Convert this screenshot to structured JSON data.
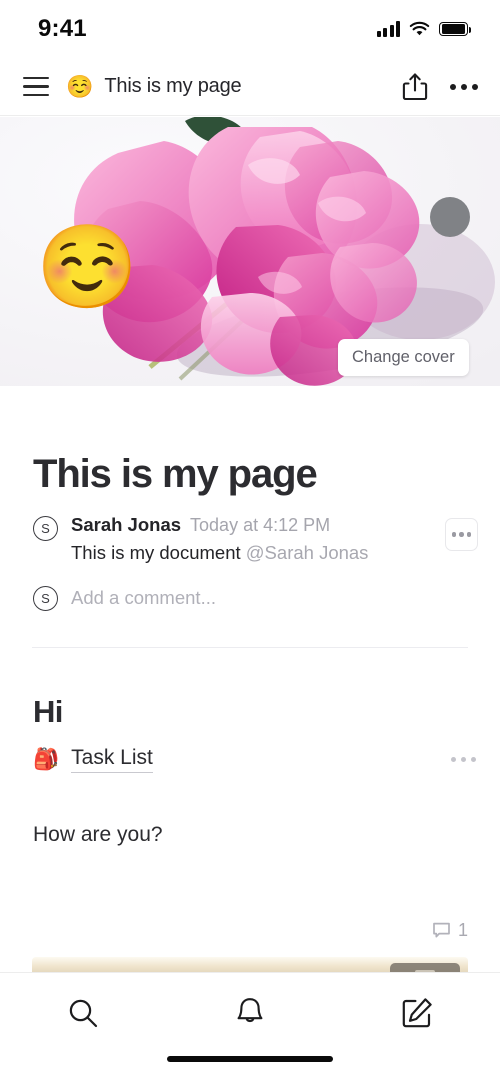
{
  "status_bar": {
    "time": "9:41",
    "signal_icon": "cellular-signal-icon",
    "wifi_icon": "wifi-icon",
    "battery_icon": "battery-full-icon"
  },
  "nav": {
    "menu_icon": "hamburger-menu-icon",
    "page_emoji": "☺️",
    "title": "This is my page",
    "share_icon": "share-icon",
    "more_icon": "more-options-icon"
  },
  "cover": {
    "alt": "pink peony flower photograph",
    "change_cover_label": "Change cover",
    "avatar_circle": "cover-avatar-circle",
    "circle_color": "#808286"
  },
  "page": {
    "emoji": "☺️",
    "title": "This is my page"
  },
  "comments": {
    "thread": [
      {
        "avatar_initial": "S",
        "author": "Sarah Jonas",
        "timestamp": "Today at 4:12 PM",
        "text": "This is my document ",
        "mention": "@Sarah Jonas"
      }
    ],
    "add_placeholder": "Add a comment...",
    "add_avatar_initial": "S",
    "more_icon": "comment-more-icon"
  },
  "content": {
    "heading": "Hi",
    "task_emoji": "🎒",
    "task_label": "Task List",
    "task_more_icon": "block-more-icon",
    "paragraph": "How are you?",
    "comment_badge": {
      "icon": "comment-bubble-icon",
      "count": "1"
    },
    "image_block": "partially-visible-image-block"
  },
  "tabbar": {
    "items": [
      {
        "name": "search",
        "icon": "search-icon"
      },
      {
        "name": "notifications",
        "icon": "bell-icon"
      },
      {
        "name": "compose",
        "icon": "compose-icon"
      }
    ]
  },
  "colors": {
    "text": "#2c2c30",
    "muted": "#a9a9b1",
    "divider": "#ececf0"
  }
}
